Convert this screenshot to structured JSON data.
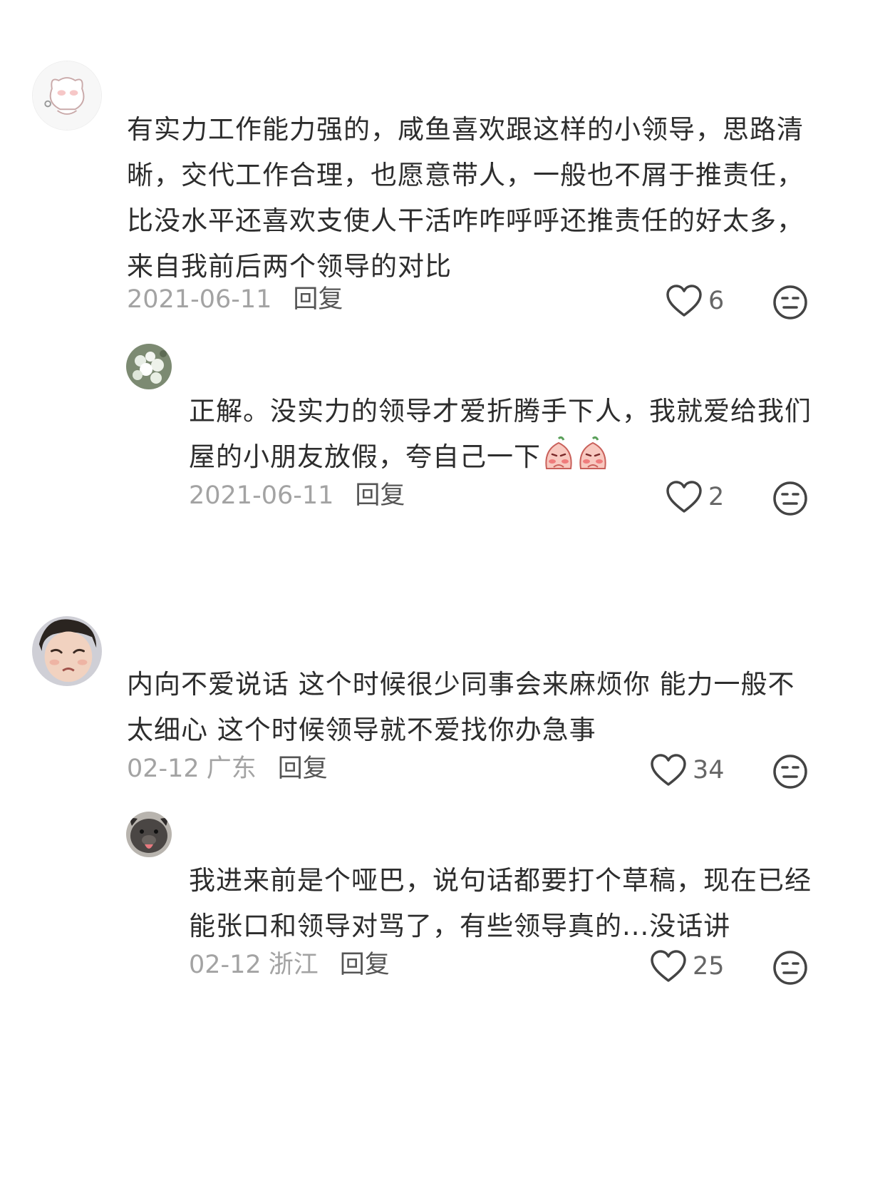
{
  "comments": [
    {
      "text": "有实力工作能力强的，咸鱼喜欢跟这样的小领导，思路清晰，交代工作合理，也愿意带人，一般也不屑于推责任，比没水平还喜欢支使人干活咋咋呼呼还推责任的好太多，来自我前后两个领导的对比",
      "date": "2021-06-11",
      "location": "",
      "reply_label": "回复",
      "likes": "6",
      "avatar_icon": "cartoon-cat-avatar-icon",
      "replies": [
        {
          "text": "正解。没实力的领导才爱折腾手下人，我就爱给我们屋的小朋友放假，夸自己一下",
          "emoji": [
            "shy-emoji-icon",
            "shy-emoji-icon"
          ],
          "date": "2021-06-11",
          "location": "",
          "reply_label": "回复",
          "likes": "2",
          "avatar_icon": "flowers-avatar-icon"
        }
      ]
    },
    {
      "text": "内向不爱说话 这个时候很少同事会来麻烦你 能力一般不太细心 这个时候领导就不爱找你办急事",
      "date": "02-12",
      "location": "广东",
      "reply_label": "回复",
      "likes": "34",
      "avatar_icon": "child-face-avatar-icon",
      "replies": [
        {
          "text": "我进来前是个哑巴，说句话都要打个草稿，现在已经能张口和领导对骂了，有些领导真的...没话讲",
          "date": "02-12",
          "location": "浙江",
          "reply_label": "回复",
          "likes": "25",
          "avatar_icon": "dog-avatar-icon"
        }
      ]
    }
  ],
  "colors": {
    "text": "#2d2d2d",
    "meta": "#a3a3a3",
    "reply": "#555555",
    "icon": "#444444"
  }
}
